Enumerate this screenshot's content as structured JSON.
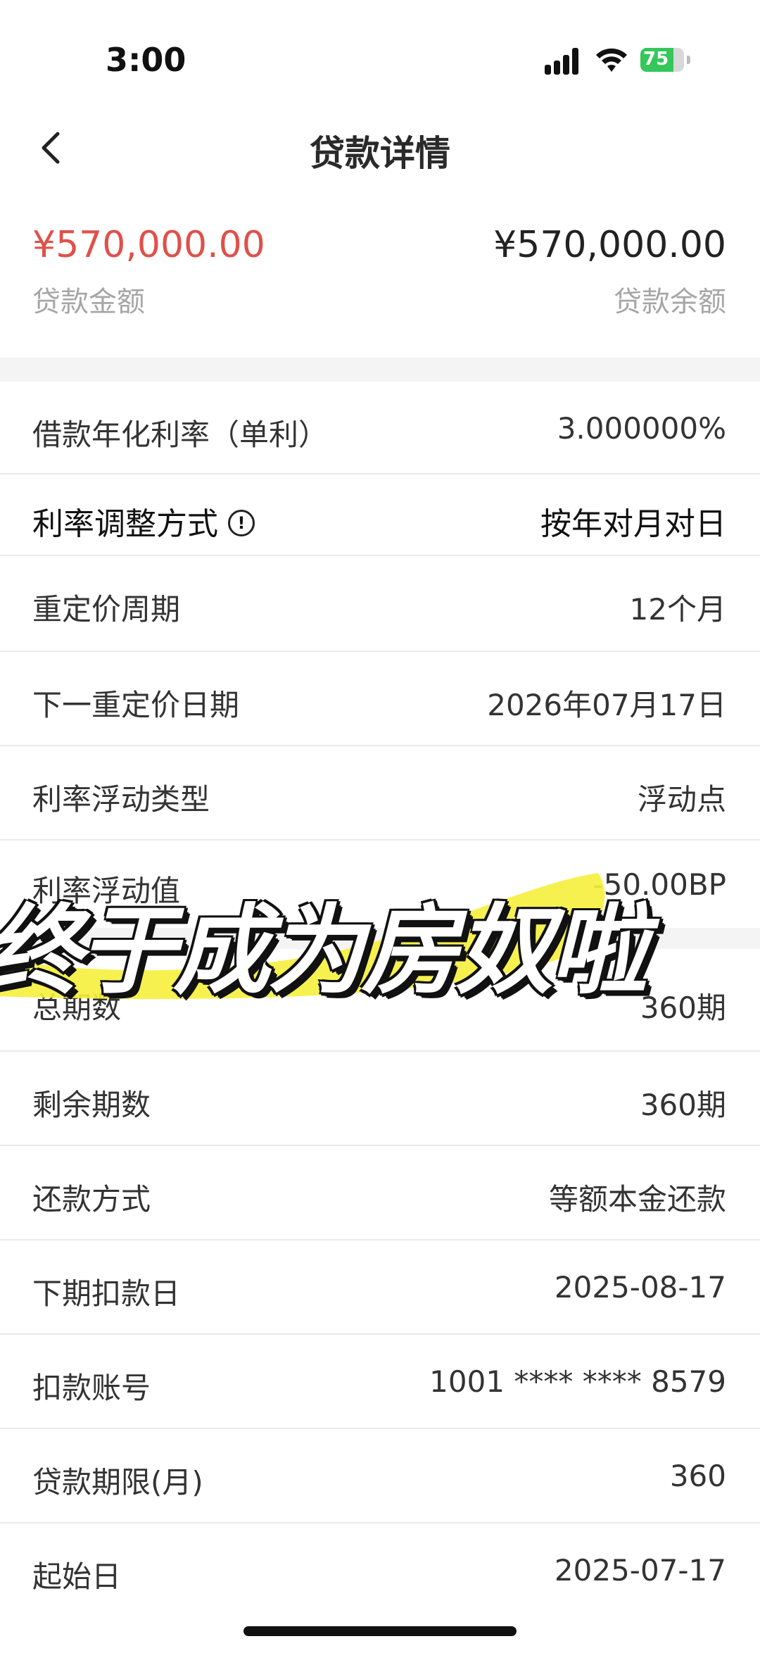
{
  "status_bar": {
    "time": "3:00",
    "battery": "75",
    "battery_level": 0.75
  },
  "header": {
    "title": "贷款详情",
    "back_icon": "chevron-left-icon"
  },
  "summary": {
    "loan_amount": "¥570,000.00",
    "loan_amount_label": "贷款金额",
    "loan_balance": "¥570,000.00",
    "loan_balance_label": "贷款余额"
  },
  "rows": [
    {
      "label": "借款年化利率（单利）",
      "value": "3.000000%"
    },
    {
      "label": "利率调整方式",
      "value": "按年对月对日",
      "info_icon": "info-icon",
      "info_glyph": "!"
    },
    {
      "label": "重定价周期",
      "value": "12个月"
    },
    {
      "label": "下一重定价日期",
      "value": "2026年07月17日"
    },
    {
      "label": "利率浮动类型",
      "value": "浮动点"
    },
    {
      "label": "利率浮动值",
      "value": "-50.00BP"
    },
    {
      "label": "总期数",
      "value": "360期"
    },
    {
      "label": "剩余期数",
      "value": "360期"
    },
    {
      "label": "还款方式",
      "value": "等额本金还款"
    },
    {
      "label": "下期扣款日",
      "value": "2025-08-17"
    },
    {
      "label": "扣款账号",
      "value": "1001 **** **** 8579"
    },
    {
      "label": "贷款期限(月)",
      "value": "360"
    },
    {
      "label": "起始日",
      "value": "2025-07-17"
    }
  ],
  "overlay": {
    "caption": "终于成为房奴啦",
    "highlight_color": "#f5f03c"
  },
  "colors": {
    "accent_red": "#e0504a",
    "muted_gray": "#a6a6a6"
  }
}
